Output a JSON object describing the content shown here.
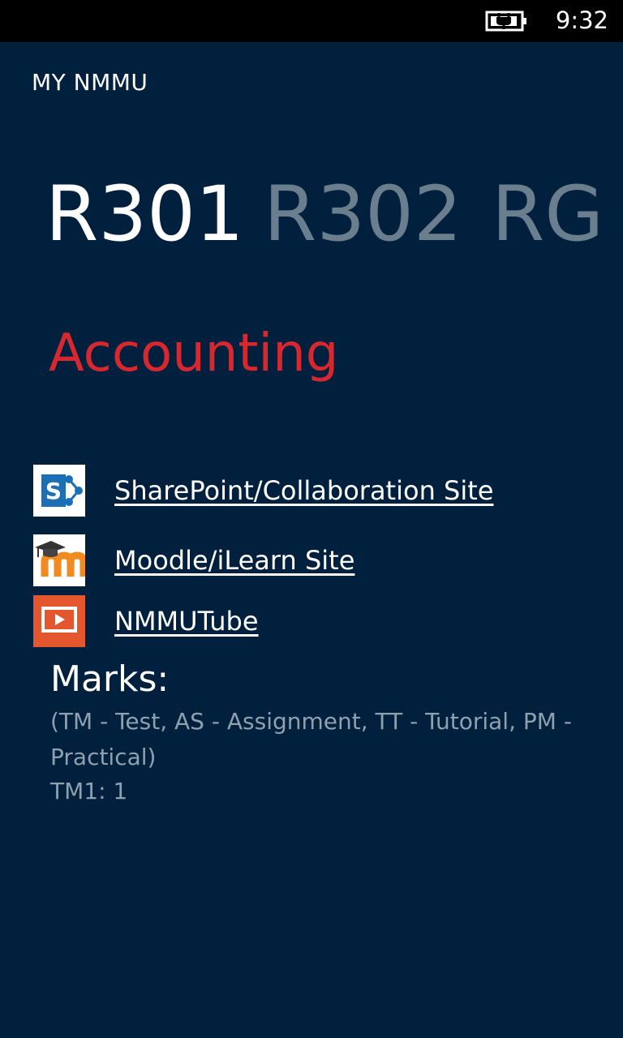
{
  "status_bar": {
    "time": "9:32",
    "battery_icon": "battery-charging-icon"
  },
  "app": {
    "title": "MY NMMU"
  },
  "pivot": {
    "items": [
      {
        "label": "R301",
        "active": true
      },
      {
        "label": "R302",
        "active": false
      },
      {
        "label": "RG",
        "active": false
      }
    ]
  },
  "course": {
    "name": "Accounting",
    "color": "#d8282f"
  },
  "links": [
    {
      "label": "SharePoint/Collaboration Site",
      "icon": "sharepoint-icon"
    },
    {
      "label": "Moodle/iLearn Site",
      "icon": "moodle-icon"
    },
    {
      "label": "NMMUTube",
      "icon": "nmmutube-icon"
    }
  ],
  "marks": {
    "heading": "Marks:",
    "legend": "(TM - Test, AS - Assignment, TT - Tutorial, PM - Practical)",
    "entries": [
      "TM1: 1"
    ]
  },
  "colors": {
    "background": "#00203d",
    "status_bar": "#000000",
    "inactive_pivot": "#6a7e8e",
    "secondary_text": "#8fa0ae"
  }
}
